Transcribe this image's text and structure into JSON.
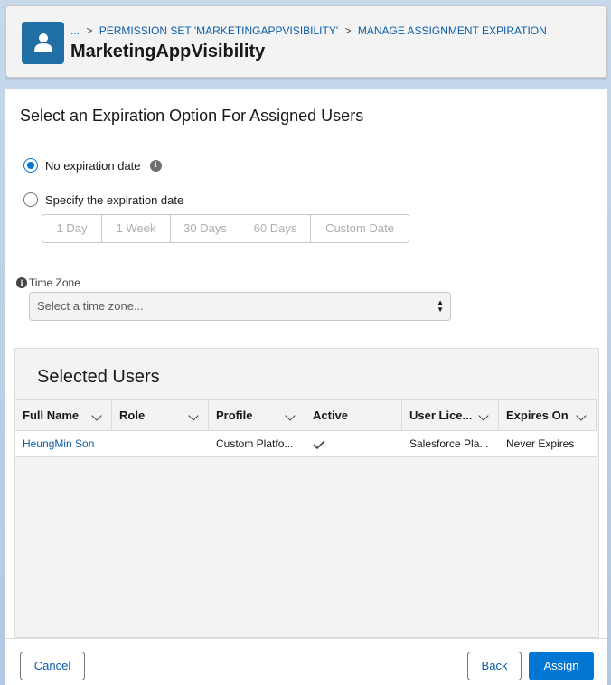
{
  "header": {
    "breadcrumb": {
      "ellipsis": "...",
      "separator": ">",
      "items": [
        "PERMISSION SET 'MARKETINGAPPVISIBILITY'",
        "MANAGE ASSIGNMENT EXPIRATION"
      ]
    },
    "title": "MarketingAppVisibility",
    "icon": "user-icon"
  },
  "expiration": {
    "heading": "Select an Expiration Option For Assigned Users",
    "options": [
      {
        "label": "No expiration date",
        "selected": true
      },
      {
        "label": "Specify the expiration date",
        "selected": false
      }
    ],
    "durations": [
      "1 Day",
      "1 Week",
      "30 Days",
      "60 Days",
      "Custom Date"
    ]
  },
  "time_zone": {
    "label": "Time Zone",
    "placeholder": "Select a time zone..."
  },
  "selected_users": {
    "title": "Selected Users",
    "columns": [
      "Full Name",
      "Role",
      "Profile",
      "Active",
      "User Lice...",
      "Expires On"
    ],
    "rows": [
      {
        "full_name": "HeungMin Son",
        "role": "",
        "profile": "Custom Platfo...",
        "active": true,
        "user_license": "Salesforce Pla...",
        "expires_on": "Never Expires"
      }
    ]
  },
  "footer": {
    "cancel_label": "Cancel",
    "back_label": "Back",
    "assign_label": "Assign"
  },
  "colors": {
    "brand": "#0176d3",
    "link": "#0b5cab",
    "header_icon_bg": "#1f6ea6"
  }
}
